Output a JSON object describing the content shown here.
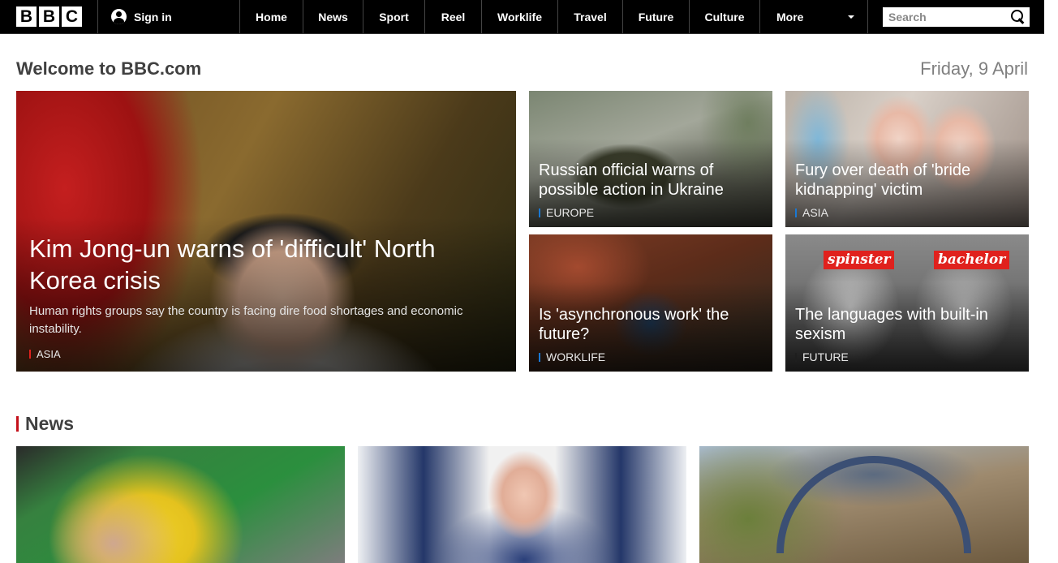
{
  "header": {
    "logo_letters": [
      "B",
      "B",
      "C"
    ],
    "sign_in_label": "Sign in",
    "nav_items": [
      "Home",
      "News",
      "Sport",
      "Reel",
      "Worklife",
      "Travel",
      "Future",
      "Culture"
    ],
    "more_label": "More",
    "search_placeholder": "Search"
  },
  "welcome": {
    "title": "Welcome to BBC.com",
    "date": "Friday, 9 April"
  },
  "hero": {
    "main": {
      "title": "Kim Jong-un warns of 'difficult' North Korea crisis",
      "summary": "Human rights groups say the country is facing dire food shortages and economic instability.",
      "tag": "ASIA",
      "tag_color": "#e0211d"
    },
    "tiles": [
      {
        "title": "Russian official warns of possible action in Ukraine",
        "tag": "EUROPE",
        "tag_color": "#1a78d3"
      },
      {
        "title": "Fury over death of 'bride kidnapping' victim",
        "tag": "ASIA",
        "tag_color": "#1a78d3"
      },
      {
        "title": "Is 'asynchronous work' the future?",
        "tag": "WORKLIFE",
        "tag_color": "#1a78d3"
      },
      {
        "title": "The languages with built-in sexism",
        "tag": "FUTURE",
        "tag_color": "#1e1e1e"
      }
    ],
    "image_labels": [
      "spinster",
      "bachelor"
    ]
  },
  "news": {
    "heading": "News",
    "accent": "#c4111b"
  },
  "colors": {
    "topbar": "#000000",
    "heading_grey": "#404040",
    "date_grey": "#808080"
  }
}
